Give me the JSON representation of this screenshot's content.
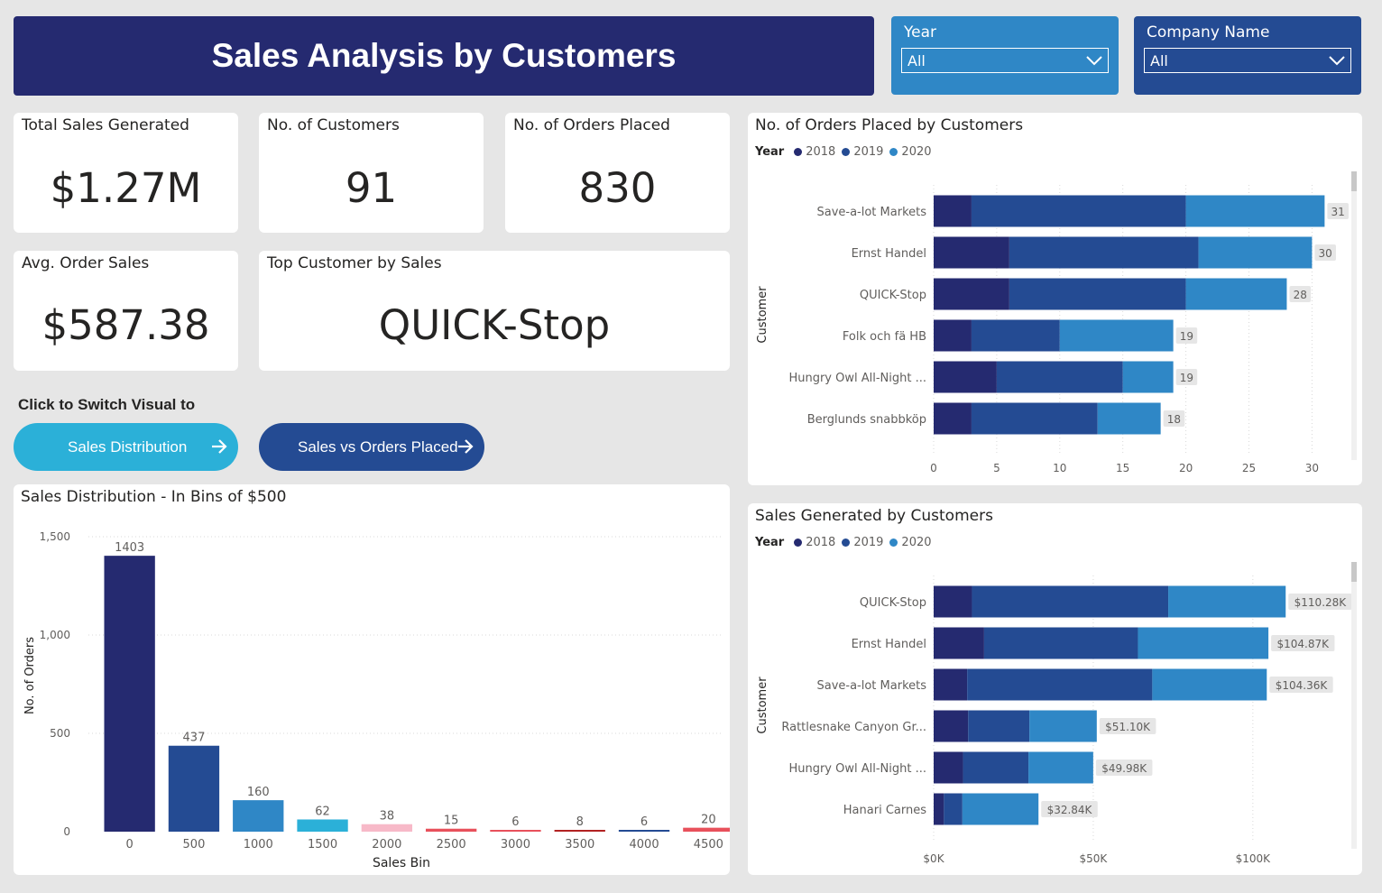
{
  "header": {
    "title": "Sales Analysis by Customers"
  },
  "filters": {
    "year": {
      "label": "Year",
      "value": "All"
    },
    "company": {
      "label": "Company Name",
      "value": "All"
    }
  },
  "kpis": {
    "total_sales": {
      "label": "Total Sales Generated",
      "value": "$1.27M"
    },
    "customers": {
      "label": "No. of Customers",
      "value": "91"
    },
    "orders": {
      "label": "No. of Orders Placed",
      "value": "830"
    },
    "avg_order": {
      "label": "Avg. Order Sales",
      "value": "$587.38"
    },
    "top_customer": {
      "label": "Top Customer by Sales",
      "value": "QUICK-Stop"
    }
  },
  "switch": {
    "label": "Click to Switch Visual to",
    "buttons": [
      "Sales Distribution",
      "Sales vs Orders Placed"
    ]
  },
  "colors": {
    "y2018": "#252a70",
    "y2019": "#244b93",
    "y2020": "#2f87c6",
    "teal": "#2bb0d8",
    "navy": "#244b93"
  },
  "chart_data": [
    {
      "type": "bar",
      "title": "Sales Distribution  - In Bins of $500",
      "xlabel": "Sales Bin",
      "ylabel": "No. of Orders",
      "categories": [
        "0",
        "500",
        "1000",
        "1500",
        "2000",
        "2500",
        "3000",
        "3500",
        "4000",
        "4500"
      ],
      "values": [
        1403,
        437,
        160,
        62,
        38,
        15,
        6,
        8,
        6,
        20
      ],
      "bar_colors": [
        "#252a70",
        "#244b93",
        "#2f87c6",
        "#2bb0d8",
        "#f7b9c8",
        "#e8505b",
        "#e8505b",
        "#b22222",
        "#244b93",
        "#e8505b"
      ],
      "ylim": [
        0,
        1500
      ],
      "yticks": [
        0,
        500,
        1000,
        1500
      ],
      "ytick_labels": [
        "0",
        "500",
        "1,000",
        "1,500"
      ]
    },
    {
      "type": "bar",
      "orientation": "horizontal",
      "stacked": true,
      "title": "No. of Orders Placed by Customers",
      "legend_title": "Year",
      "ylabel": "Customer",
      "categories": [
        "Save-a-lot Markets",
        "Ernst Handel",
        "QUICK-Stop",
        "Folk och fä HB",
        "Hungry Owl All-Night ...",
        "Berglunds snabbköp"
      ],
      "series": [
        {
          "name": "2018",
          "values": [
            3,
            6,
            6,
            3,
            5,
            3
          ]
        },
        {
          "name": "2019",
          "values": [
            17,
            15,
            14,
            7,
            10,
            10
          ]
        },
        {
          "name": "2020",
          "values": [
            11,
            9,
            8,
            9,
            4,
            5
          ]
        }
      ],
      "totals": [
        "31",
        "30",
        "28",
        "19",
        "19",
        "18"
      ],
      "xlim": [
        0,
        33
      ],
      "xticks": [
        0,
        5,
        10,
        15,
        20,
        25,
        30
      ],
      "xtick_labels": [
        "0",
        "5",
        "10",
        "15",
        "20",
        "25",
        "30"
      ]
    },
    {
      "type": "bar",
      "orientation": "horizontal",
      "stacked": true,
      "title": "Sales Generated by Customers",
      "legend_title": "Year",
      "ylabel": "Customer",
      "categories": [
        "QUICK-Stop",
        "Ernst Handel",
        "Save-a-lot Markets",
        "Rattlesnake Canyon Gr...",
        "Hungry Owl All-Night ...",
        "Hanari Carnes"
      ],
      "series": [
        {
          "name": "2018",
          "values": [
            12.0,
            15.8,
            10.5,
            10.8,
            9.2,
            3.2
          ]
        },
        {
          "name": "2019",
          "values": [
            61.5,
            48.2,
            58.0,
            19.2,
            20.5,
            5.8
          ]
        },
        {
          "name": "2020",
          "values": [
            36.78,
            40.87,
            35.86,
            21.1,
            20.28,
            23.84
          ]
        }
      ],
      "totals": [
        "$110.28K",
        "$104.87K",
        "$104.36K",
        "$51.10K",
        "$49.98K",
        "$32.84K"
      ],
      "xlim": [
        0,
        130
      ],
      "xticks": [
        0,
        50,
        100
      ],
      "xtick_labels": [
        "$0K",
        "$50K",
        "$100K"
      ]
    }
  ]
}
